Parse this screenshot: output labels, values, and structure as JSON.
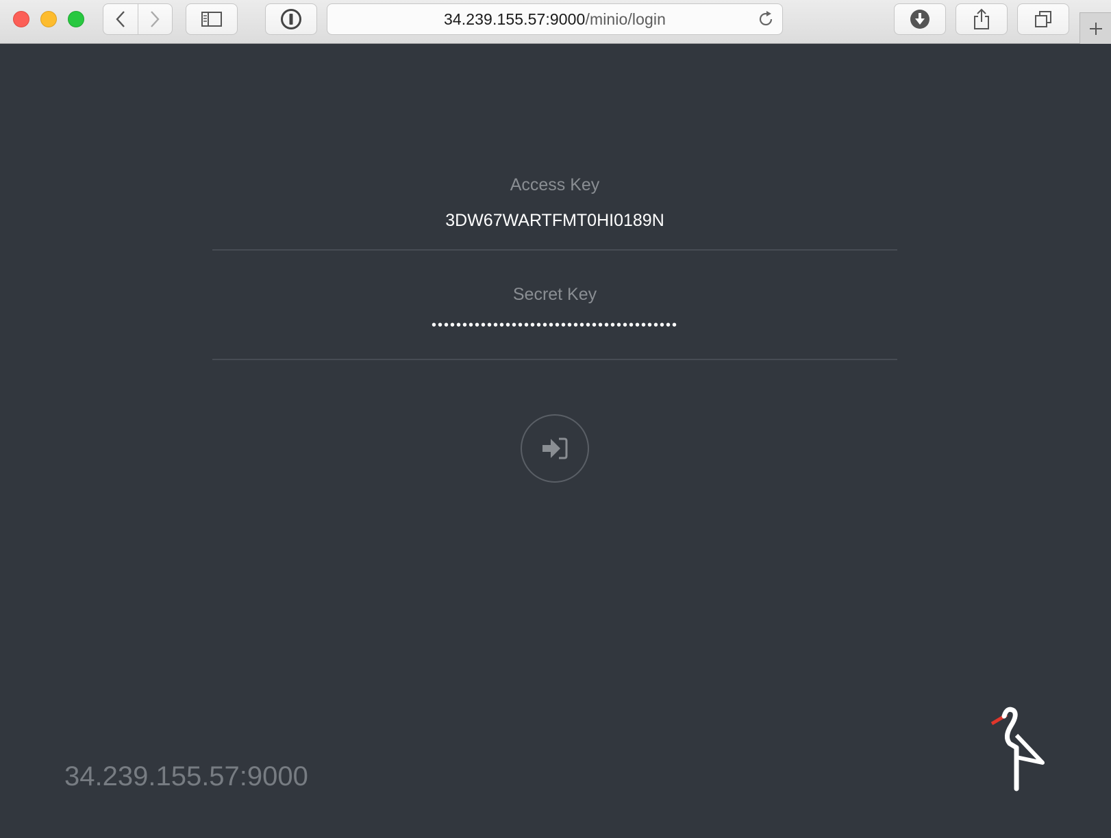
{
  "browser": {
    "url_host": "34.239.155.57:9000",
    "url_path": "/minio/login",
    "icons": [
      "back-icon",
      "forward-icon",
      "sidebar-icon",
      "password-manager-icon",
      "reload-icon",
      "download-icon",
      "share-icon",
      "tabs-icon",
      "new-tab-icon"
    ]
  },
  "login": {
    "access_key_label": "Access Key",
    "access_key_value": "3DW67WARTFMT0HI0189N",
    "secret_key_label": "Secret Key",
    "secret_key_value": "••••••••••••••••••••••••••••••••••••••••",
    "submit_icon": "sign-in-icon"
  },
  "footer": {
    "host": "34.239.155.57:9000"
  },
  "colors": {
    "background": "#32373e",
    "logo_accent": "#e1362b"
  }
}
